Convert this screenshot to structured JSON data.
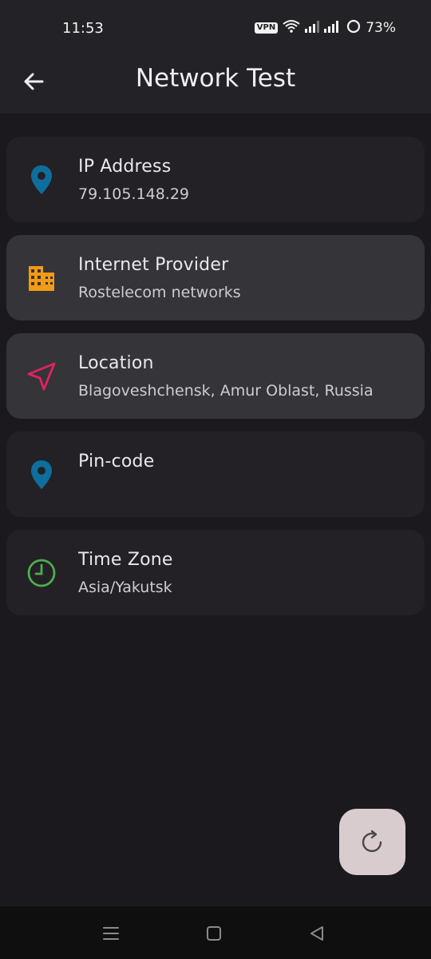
{
  "status_bar": {
    "time": "11:53",
    "vpn_label": "VPN",
    "battery": "73%"
  },
  "app_bar": {
    "title": "Network Test"
  },
  "cards": [
    {
      "title": "IP Address",
      "value": "79.105.148.29",
      "icon": "location-pin-icon",
      "color": "#0e6e9c"
    },
    {
      "title": "Internet Provider",
      "value": "Rostelecom networks",
      "icon": "building-icon",
      "color": "#f29b16"
    },
    {
      "title": "Location",
      "value": "Blagoveshchensk, Amur Oblast, Russia",
      "icon": "navigation-arrow-icon",
      "color": "#e0245e"
    },
    {
      "title": "Pin-code",
      "value": "",
      "icon": "location-pin-icon",
      "color": "#0e6e9c"
    },
    {
      "title": "Time Zone",
      "value": "Asia/Yakutsk",
      "icon": "clock-icon",
      "color": "#4caf50"
    }
  ],
  "fab": {
    "icon": "refresh-icon"
  },
  "nav_bar": {
    "icons": [
      "menu-icon",
      "home-icon",
      "back-triangle-icon"
    ]
  }
}
